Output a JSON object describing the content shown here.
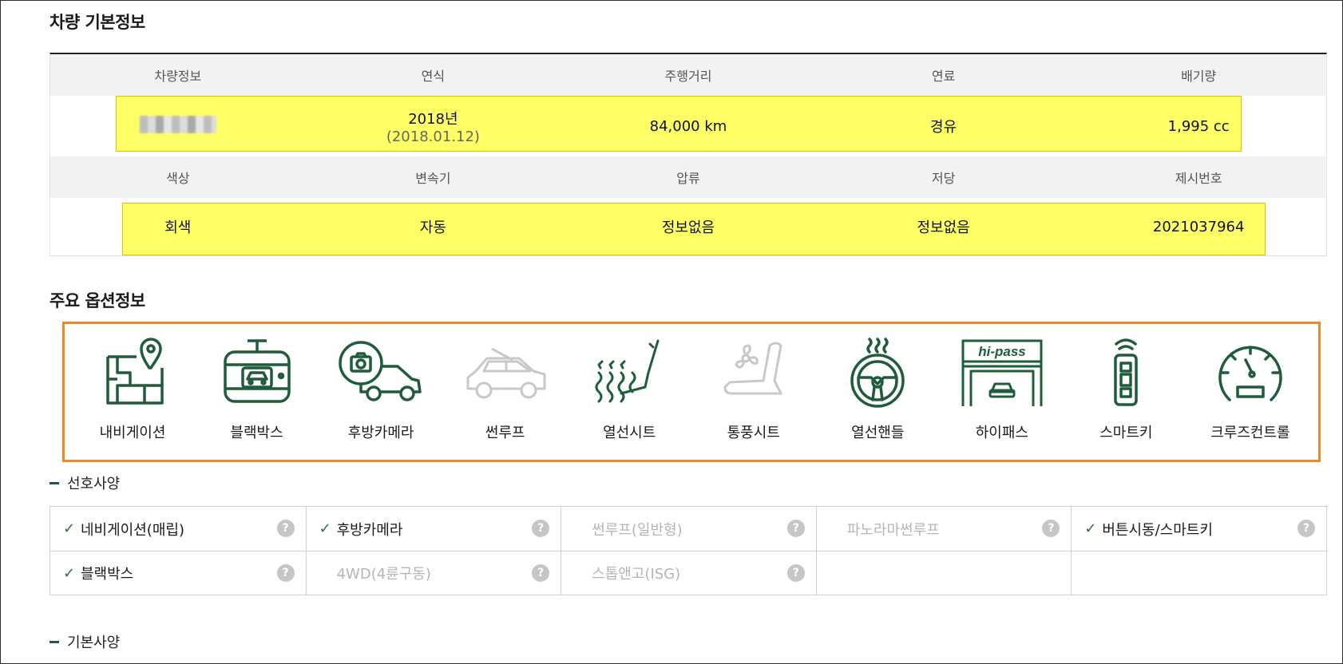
{
  "headings": {
    "basic_info": "차량 기본정보",
    "main_options": "주요 옵션정보",
    "preferred": "선호사양",
    "standard": "기본사양"
  },
  "basic_info": {
    "row1_headers": [
      "차량정보",
      "연식",
      "주행거리",
      "연료",
      "배기량"
    ],
    "row1_values": {
      "vehicle": "",
      "year": "2018년",
      "year_date": "(2018.01.12)",
      "mileage": "84,000 km",
      "fuel": "경유",
      "displacement": "1,995 cc"
    },
    "row2_headers": [
      "색상",
      "변속기",
      "압류",
      "저당",
      "제시번호"
    ],
    "row2_values": [
      "회색",
      "자동",
      "정보없음",
      "정보없음",
      "2021037964"
    ]
  },
  "options": [
    {
      "label": "내비게이션",
      "icon": "navigation-map-icon",
      "active": true
    },
    {
      "label": "블랙박스",
      "icon": "dashcam-icon",
      "active": true
    },
    {
      "label": "후방카메라",
      "icon": "rear-camera-icon",
      "active": true
    },
    {
      "label": "썬루프",
      "icon": "sunroof-car-icon",
      "active": false
    },
    {
      "label": "열선시트",
      "icon": "heated-seat-icon",
      "active": true
    },
    {
      "label": "통풍시트",
      "icon": "ventilated-seat-icon",
      "active": false
    },
    {
      "label": "열선핸들",
      "icon": "heated-steering-wheel-icon",
      "active": true
    },
    {
      "label": "하이패스",
      "icon": "hipass-gate-icon",
      "active": true,
      "logo_text": "hi-pass"
    },
    {
      "label": "스마트키",
      "icon": "smart-key-icon",
      "active": true
    },
    {
      "label": "크루즈컨트롤",
      "icon": "cruise-control-gauge-icon",
      "active": true
    }
  ],
  "preferred": {
    "rows": [
      [
        {
          "label": "네비게이션(매립)",
          "checked": true
        },
        {
          "label": "후방카메라",
          "checked": true
        },
        {
          "label": "썬루프(일반형)",
          "checked": false
        },
        {
          "label": "파노라마썬루프",
          "checked": false
        },
        {
          "label": "버튼시동/스마트키",
          "checked": true
        }
      ],
      [
        {
          "label": "블랙박스",
          "checked": true
        },
        {
          "label": "4WD(4륜구동)",
          "checked": false
        },
        {
          "label": "스톱앤고(ISG)",
          "checked": false
        },
        {
          "label": "",
          "checked": false
        },
        {
          "label": "",
          "checked": false
        }
      ]
    ],
    "help_glyph": "?",
    "check_glyph": "✓"
  },
  "colors": {
    "icon_active": "#1e5c3a",
    "icon_inactive": "#c8c8c8",
    "highlight": "#ffff66",
    "option_border": "#e9892c"
  }
}
